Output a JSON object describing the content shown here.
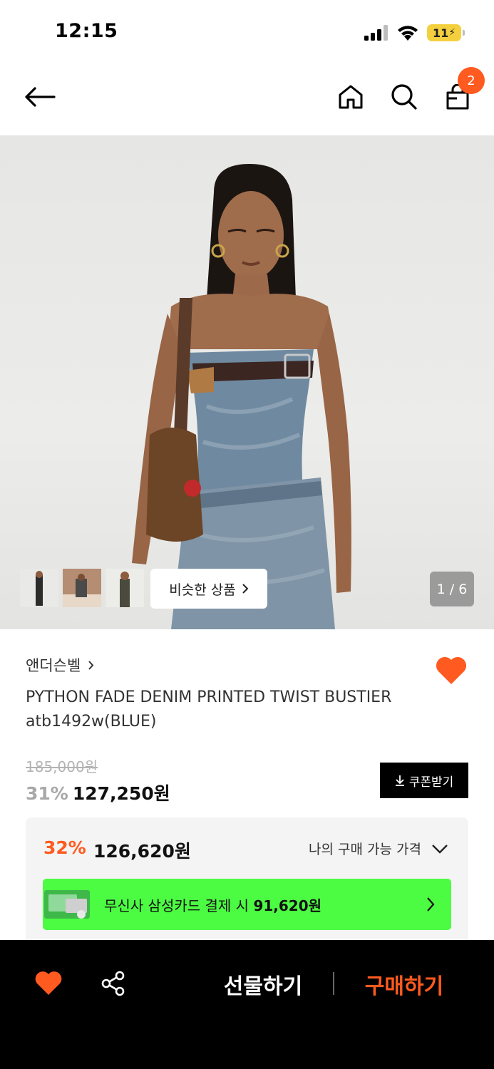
{
  "status_bar": {
    "time": "12:15",
    "battery": "11",
    "icons": [
      "cellular-signal-icon",
      "wifi-icon",
      "battery-charging-icon"
    ]
  },
  "nav": {
    "icons": [
      "back-arrow-icon",
      "home-icon",
      "search-icon",
      "shopping-bag-icon"
    ],
    "cart_count": "2"
  },
  "gallery": {
    "similar_label": "비슷한 상품",
    "page_indicator": "1 / 6",
    "image_subject": "model wearing blue python print denim bustier and skirt with brown shearling shoulder bag"
  },
  "product": {
    "brand": "앤더슨벨",
    "name": "PYTHON FADE DENIM PRINTED TWIST BUSTIER atb1492w(BLUE)",
    "original_price": "185,000원",
    "discount_rate": "31%",
    "sale_price": "127,250원",
    "coupon_label": "쿠폰받기"
  },
  "my_price": {
    "rate": "32%",
    "price": "126,620원",
    "label": "나의 구매 가능 가격",
    "card_banner_prefix": "무신사 삼성카드 결제 시 ",
    "card_banner_price": "91,620원"
  },
  "bottom_bar": {
    "gift_label": "선물하기",
    "buy_label": "구매하기"
  },
  "colors": {
    "accent": "#ff5a1f",
    "card_banner": "#4cfc43",
    "bottom_bar": "#000000"
  }
}
